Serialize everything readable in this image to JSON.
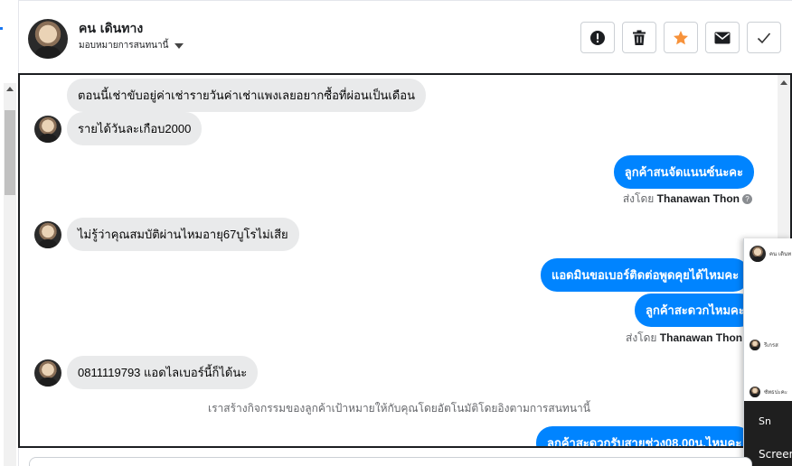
{
  "header": {
    "contact_name": "คน เดินทาง",
    "assign_label": "มอบหมายการสนทนานี้",
    "actions": [
      {
        "name": "alert-button",
        "icon": "exclamation-circle-icon"
      },
      {
        "name": "delete-button",
        "icon": "trash-icon"
      },
      {
        "name": "star-button",
        "icon": "star-icon",
        "color": "#f7923a"
      },
      {
        "name": "mail-button",
        "icon": "envelope-icon"
      },
      {
        "name": "done-button",
        "icon": "check-icon"
      }
    ]
  },
  "messages": {
    "in_1": "ตอนนี้เช่าขับอยู่ค่าเช่ารายวันค่าเช่าแพงเลยอยากซื้อที่ผ่อนเป็นเดือน",
    "in_2": "รายได้วันละเกือบ2000",
    "out_1": "ลูกค้าสนจัดแนนซ์นะคะ",
    "sent_by_1_prefix": "ส่งโดย",
    "sent_by_1_name": "Thanawan Thon",
    "in_3": "ไม่รู้ว่าคุณสมบัติผ่านไหมอายุ67บูโรไม่เสีย",
    "out_2": "แอดมินขอเบอร์ติดต่อพูดคุยได้ไหมคะ",
    "out_3": "ลูกค้าสะดวกไหมคะ",
    "sent_by_2_prefix": "ส่งโดย",
    "sent_by_2_name": "Thanawan Thon",
    "in_4": "0811119793 แอดไลเบอร์นี้ก็ได้นะ",
    "system_note": "เราสร้างกิจกรรมของลูกค้าเป้าหมายให้กับคุณโดยอัตโนมัติโดยอิงตามการสนทนานี้",
    "out_4": "ลูกค้าสะดวกรับสายช่วง08.00น.ไหมคะ"
  },
  "mini_window": {
    "title": "คน เดินท",
    "item_1": "รีเกรส",
    "item_2": "ซัทธปะคะ",
    "snip_label": "Sn",
    "screen_label": "Screen"
  },
  "colors": {
    "accent": "#0084ff",
    "incoming_bubble": "#e9eaeb",
    "star": "#f7923a"
  }
}
